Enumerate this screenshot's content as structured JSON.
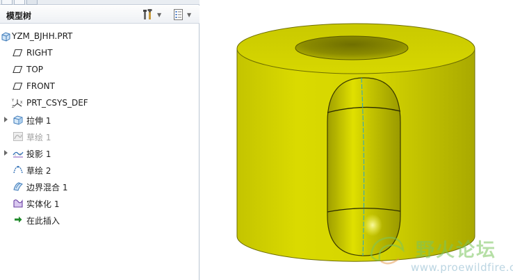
{
  "model_tree": {
    "title": "模型树",
    "root": {
      "label": "YZM_BJHH.PRT",
      "icon": "part-icon"
    },
    "items": [
      {
        "label": "RIGHT",
        "icon": "datum-plane-icon",
        "expandable": false,
        "dimmed": false
      },
      {
        "label": "TOP",
        "icon": "datum-plane-icon",
        "expandable": false,
        "dimmed": false
      },
      {
        "label": "FRONT",
        "icon": "datum-plane-icon",
        "expandable": false,
        "dimmed": false
      },
      {
        "label": "PRT_CSYS_DEF",
        "icon": "coordinate-system-icon",
        "expandable": false,
        "dimmed": false
      },
      {
        "label": "拉伸 1",
        "icon": "extrude-icon",
        "expandable": true,
        "dimmed": false
      },
      {
        "label": "草绘 1",
        "icon": "sketch-icon",
        "expandable": false,
        "dimmed": true
      },
      {
        "label": "投影 1",
        "icon": "projection-icon",
        "expandable": true,
        "dimmed": false
      },
      {
        "label": "草绘 2",
        "icon": "sketch-icon",
        "expandable": false,
        "dimmed": false
      },
      {
        "label": "边界混合 1",
        "icon": "boundary-blend-icon",
        "expandable": false,
        "dimmed": false
      },
      {
        "label": "实体化 1",
        "icon": "solidify-icon",
        "expandable": false,
        "dimmed": false
      },
      {
        "label": "在此插入",
        "icon": "insert-here-arrow-icon",
        "expandable": false,
        "dimmed": false
      }
    ]
  },
  "toolbar": {
    "settings_icon": "tools-icon",
    "show_icon": "show-list-icon"
  },
  "watermark": {
    "text": "野火论坛",
    "url": "www.proewildfire.cn",
    "logo": "leaf-swirl-logo"
  },
  "colors": {
    "model_yellow": "#d4d400",
    "model_shadow": "#a8a800",
    "panel_border": "#b9c4d2",
    "watermark_green": "#7ac45c"
  }
}
